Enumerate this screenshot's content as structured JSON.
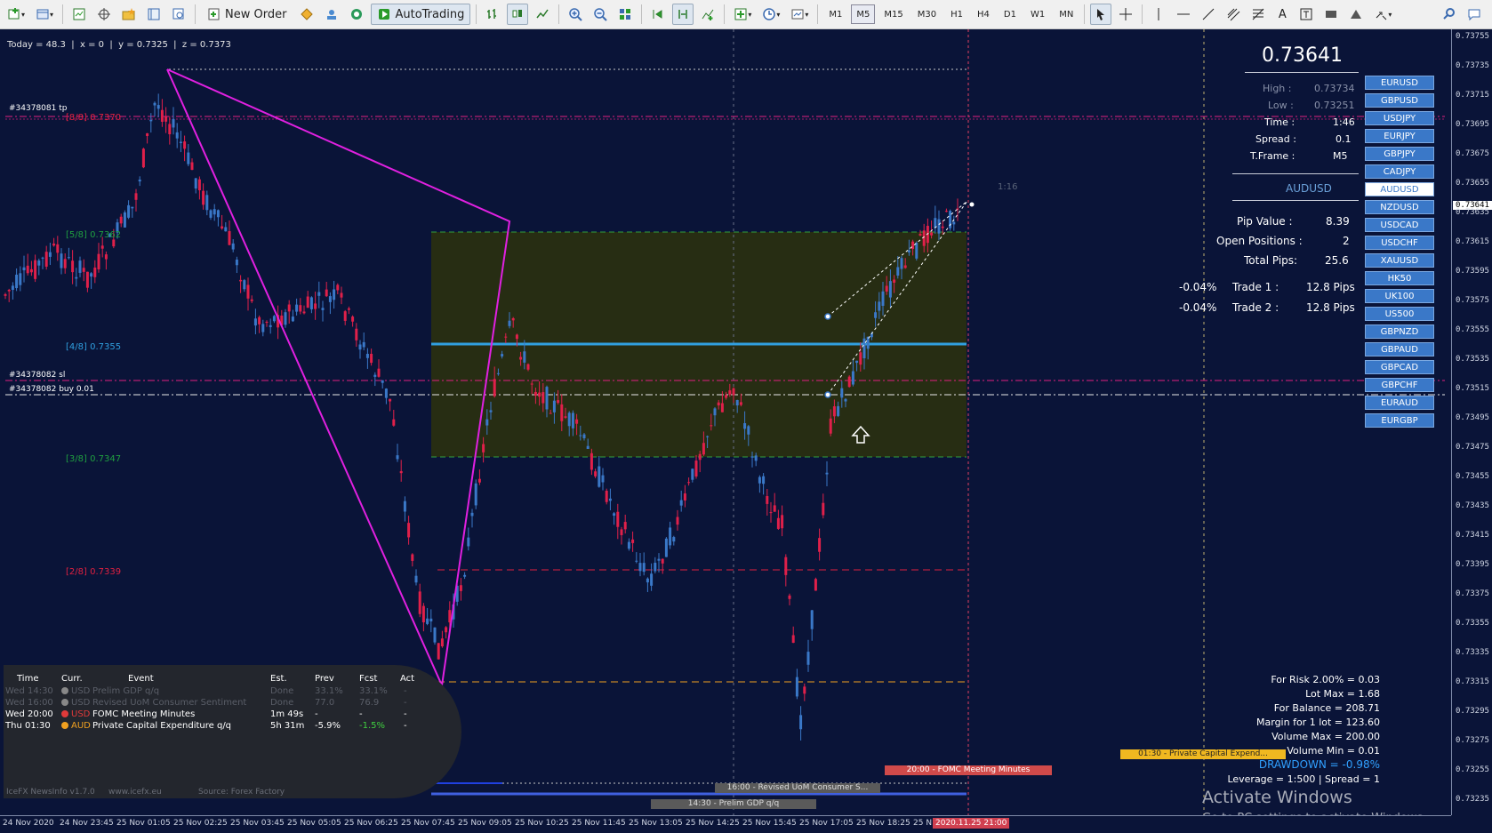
{
  "toolbar": {
    "new_order": "New Order",
    "autotrading": "AutoTrading",
    "timeframes": [
      "M1",
      "M5",
      "M15",
      "M30",
      "H1",
      "H4",
      "D1",
      "W1",
      "MN"
    ],
    "active_timeframe": "M5"
  },
  "info_bar": {
    "today": "Today = 48.3",
    "x": "x = 0",
    "y": "y = 0.7325",
    "z": "z = 0.7373"
  },
  "chart": {
    "symbol": "AUDUSD",
    "timeframe": "M5",
    "timer_label": "1:16",
    "order_labels": {
      "tp": "#34378081 tp",
      "sl": "#34378082 sl",
      "buy": "#34378082 buy 0.01"
    },
    "murrey_levels": [
      {
        "label": "[8/8]",
        "price": "0.7370",
        "color": "#e02040"
      },
      {
        "label": "[5/8]",
        "price": "0.7362",
        "color": "#20a040"
      },
      {
        "label": "[4/8]",
        "price": "0.7355",
        "color": "#30a0e0"
      },
      {
        "label": "[3/8]",
        "price": "0.7347",
        "color": "#20a040"
      },
      {
        "label": "[2/8]",
        "price": "0.7339",
        "color": "#e02040"
      }
    ],
    "colors": {
      "bull": "#3a78c8",
      "bear": "#e0204a",
      "zigzag": "#e020e0",
      "zone": "#2a3010",
      "background": "#0a1438"
    }
  },
  "price_axis": {
    "ticks": [
      "0.73755",
      "0.73735",
      "0.73715",
      "0.73695",
      "0.73675",
      "0.73655",
      "0.73635",
      "0.73615",
      "0.73595",
      "0.73575",
      "0.73555",
      "0.73535",
      "0.73515",
      "0.73495",
      "0.73475",
      "0.73455",
      "0.73435",
      "0.73415",
      "0.73395",
      "0.73375",
      "0.73355",
      "0.73335",
      "0.73315",
      "0.73295",
      "0.73275",
      "0.73255",
      "0.73235"
    ],
    "current_tag": "0.73641"
  },
  "time_axis": {
    "ticks": [
      "24 Nov 2020",
      "24 Nov 23:45",
      "25 Nov 01:05",
      "25 Nov 02:25",
      "25 Nov 03:45",
      "25 Nov 05:05",
      "25 Nov 06:25",
      "25 Nov 07:45",
      "25 Nov 09:05",
      "25 Nov 10:25",
      "25 Nov 11:45",
      "25 Nov 13:05",
      "25 Nov 14:25",
      "25 Nov 15:45",
      "25 Nov 17:05",
      "25 Nov 18:25",
      "25 N"
    ],
    "highlight": "2020.11.25 21:00"
  },
  "panel": {
    "price": "0.73641",
    "high_label": "High :",
    "high": "0.73734",
    "low_label": "Low :",
    "low": "0.73251",
    "time_label": "Time :",
    "time": "1:46",
    "spread_label": "Spread :",
    "spread": "0.1",
    "tframe_label": "T.Frame :",
    "tframe": "M5",
    "symbol": "AUDUSD",
    "pip_value_label": "Pip Value :",
    "pip_value": "8.39",
    "open_positions_label": "Open Positions :",
    "open_positions": "2",
    "total_pips_label": "Total Pips:",
    "total_pips": "25.6",
    "trades": [
      {
        "pct": "-0.04%",
        "label": "Trade 1 :",
        "pips": "12.8 Pips"
      },
      {
        "pct": "-0.04%",
        "label": "Trade 2 :",
        "pips": "12.8 Pips"
      }
    ]
  },
  "symbols": [
    "EURUSD",
    "GBPUSD",
    "USDJPY",
    "EURJPY",
    "GBPJPY",
    "CADJPY",
    "AUDUSD",
    "NZDUSD",
    "USDCAD",
    "USDCHF",
    "XAUUSD",
    "HK50",
    "UK100",
    "US500",
    "GBPNZD",
    "GBPAUD",
    "GBPCAD",
    "GBPCHF",
    "EURAUD",
    "EURGBP"
  ],
  "selected_symbol": "AUDUSD",
  "risk": {
    "for_risk": "For Risk 2.00% = 0.03",
    "lot_max": "Lot Max = 1.68",
    "for_balance": "For Balance = 208.71",
    "margin": "Margin for 1 lot = 123.60",
    "volume_max": "Volume Max = 200.00",
    "volume_min": "Volume Min = 0.01",
    "drawdown": "DRAWDOWN = -0.98%",
    "leverage": "Leverage = 1:500 | Spread = 1"
  },
  "news": {
    "headers": [
      "Time",
      "Curr.",
      "Event",
      "Est.",
      "Prev",
      "Fcst",
      "Act"
    ],
    "rows": [
      {
        "time": "Wed 14:30",
        "curr": "USD",
        "event": "Prelim GDP q/q",
        "est": "Done",
        "prev": "33.1%",
        "fcst": "33.1%",
        "act": "-",
        "state": "past",
        "impact": "#888888"
      },
      {
        "time": "Wed 16:00",
        "curr": "USD",
        "event": "Revised UoM Consumer Sentiment",
        "est": "Done",
        "prev": "77.0",
        "fcst": "76.9",
        "act": "-",
        "state": "past",
        "impact": "#888888"
      },
      {
        "time": "Wed 20:00",
        "curr": "USD",
        "event": "FOMC Meeting Minutes",
        "est": "1m 49s",
        "prev": "-",
        "fcst": "-",
        "act": "-",
        "state": "next",
        "impact": "#e03a3a"
      },
      {
        "time": "Thu 01:30",
        "curr": "AUD",
        "event": "Private Capital Expenditure q/q",
        "est": "5h 31m",
        "prev": "-5.9%",
        "fcst": "-1.5%",
        "act": "-",
        "state": "future",
        "impact": "#f0a020"
      }
    ],
    "footer_left": "IceFX NewsInfo v1.7.0",
    "footer_url": "www.icefx.eu",
    "footer_source": "Source: Forex Factory"
  },
  "events": {
    "fomc": "20:00 - FOMC Meeting Minutes",
    "capex": "01:30 - Private Capital Expend...",
    "uom": "16:00 - Revised UoM Consumer S...",
    "gdp": "14:30 - Prelim GDP q/q"
  },
  "watermark": {
    "title": "Activate Windows",
    "subtitle": "Go to PC settings to activate Windows."
  }
}
